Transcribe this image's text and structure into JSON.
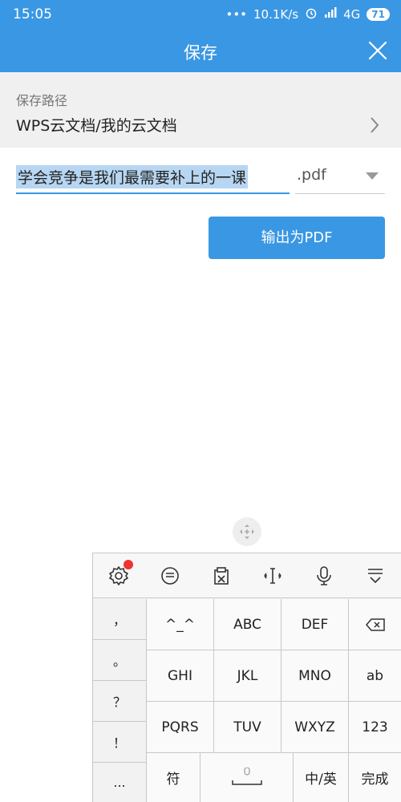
{
  "status_bar": {
    "time": "15:05",
    "network_speed": "10.1K/s",
    "signal": "4G",
    "battery": "71"
  },
  "header": {
    "title": "保存",
    "close_icon": "close-icon"
  },
  "save_path": {
    "label": "保存路径",
    "value": "WPS云文档/我的云文档"
  },
  "file": {
    "name": "学会竞争是我们最需要补上的一课",
    "extension": ".pdf"
  },
  "export_button": {
    "label": "输出为PDF"
  },
  "keyboard": {
    "toolbar": [
      "settings-icon",
      "message-icon",
      "clipboard-icon",
      "cursor-icon",
      "microphone-icon",
      "hide-keyboard-icon"
    ],
    "punct_keys": [
      "，",
      "。",
      "？",
      "！",
      "..."
    ],
    "keys": {
      "k1": "^_^",
      "k2": "ABC",
      "k3": "DEF",
      "k4": "GHI",
      "k5": "JKL",
      "k6": "MNO",
      "k7": "PQRS",
      "k8": "TUV",
      "k9": "WXYZ",
      "ab": "ab",
      "num": "123",
      "symbol": "符",
      "lang": "中/英",
      "done": "完成"
    }
  },
  "colors": {
    "primary": "#3a97e3",
    "selection": "#b7d6f2",
    "badge_red": "#ee3333"
  }
}
